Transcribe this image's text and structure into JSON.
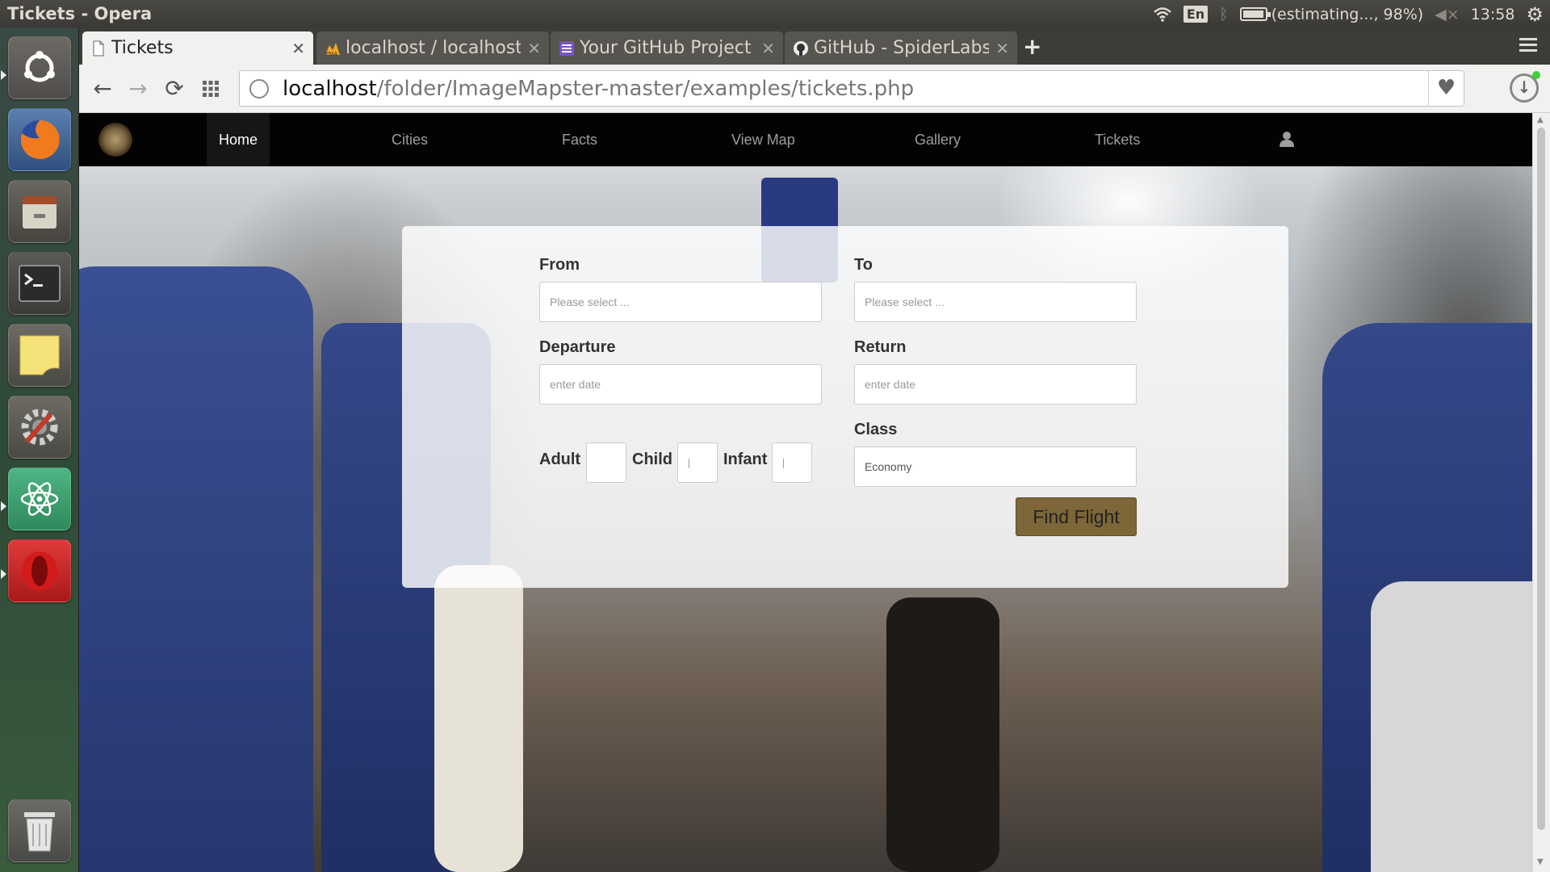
{
  "window": {
    "title": "Tickets - Opera"
  },
  "tray": {
    "keyboard": "En",
    "battery_text": "(estimating..., 98%)",
    "battery_level": 0.98,
    "time": "13:58",
    "icons": [
      "wifi-icon",
      "bluetooth-icon",
      "battery-icon",
      "volume-muted-icon",
      "settings-gear-icon"
    ]
  },
  "launcher": {
    "apps": [
      "ubuntu-dash-icon",
      "firefox-icon",
      "files-icon",
      "terminal-icon",
      "notes-icon",
      "system-settings-icon",
      "atom-icon",
      "opera-icon",
      "trash-icon"
    ]
  },
  "tabs": [
    {
      "label": "Tickets",
      "icon": "page-icon",
      "active": true
    },
    {
      "label": "localhost / localhost / ",
      "icon": "phpmyadmin-icon",
      "active": false
    },
    {
      "label": "Your GitHub Project",
      "icon": "project-icon",
      "active": false
    },
    {
      "label": "GitHub - SpiderLabs/",
      "icon": "github-icon",
      "active": false
    }
  ],
  "address": {
    "host": "localhost",
    "path": "/folder/ImageMapster-master/examples/tickets.php"
  },
  "nav": {
    "items": [
      "Home",
      "Cities",
      "Facts",
      "View Map",
      "Gallery",
      "Tickets"
    ],
    "active": "Home"
  },
  "form": {
    "from_label": "From",
    "from_placeholder": "Please select ...",
    "to_label": "To",
    "to_placeholder": "Please select ...",
    "departure_label": "Departure",
    "departure_placeholder": "enter date",
    "return_label": "Return",
    "return_placeholder": "enter date",
    "adult_label": "Adult",
    "child_label": "Child",
    "infant_label": "Infant",
    "class_label": "Class",
    "class_value": "Economy",
    "submit_label": "Find Flight"
  },
  "colors": {
    "nav_bg": "#030303",
    "button_bg": "#7d6638",
    "card_bg": "rgba(255,255,255,0.82)"
  }
}
